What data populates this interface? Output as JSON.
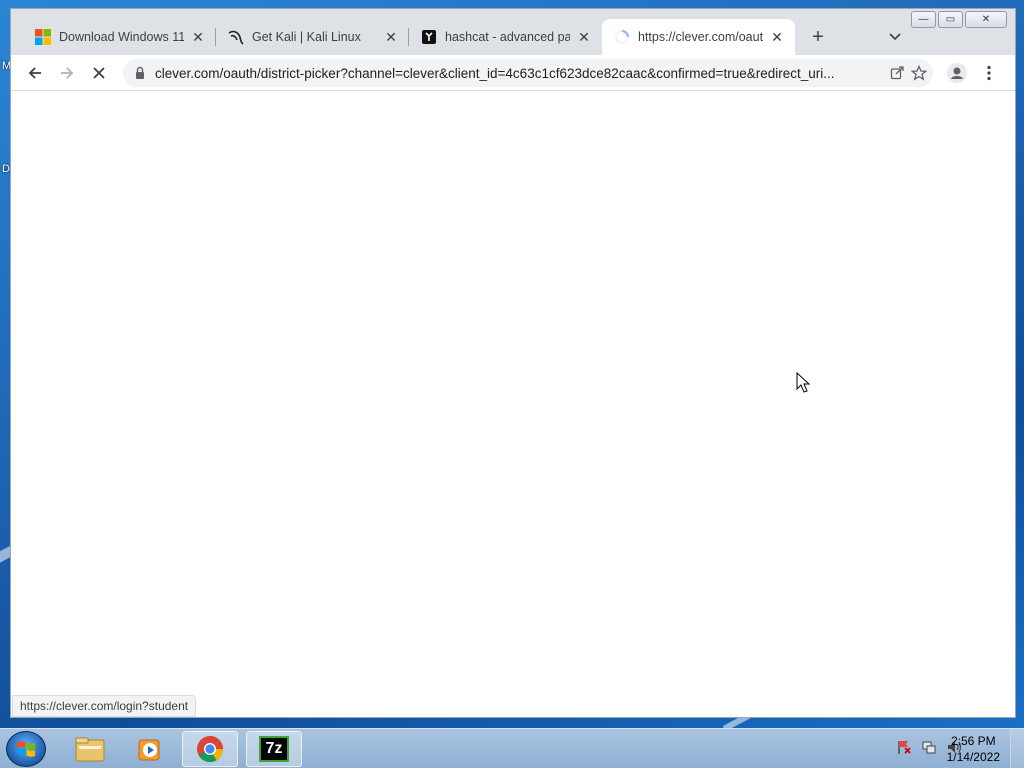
{
  "desktop": {
    "left_labels": [
      "M",
      "D"
    ]
  },
  "window": {
    "caption_buttons": {
      "minimize": "—",
      "maximize": "▭",
      "close": "✕"
    }
  },
  "tabs": [
    {
      "title": "Download Windows 11",
      "favicon": "windows-logo-icon"
    },
    {
      "title": "Get Kali | Kali Linux",
      "favicon": "kali-dragon-icon"
    },
    {
      "title": "hashcat - advanced password recovery",
      "favicon": "hashcat-cat-icon"
    },
    {
      "title": "https://clever.com/oauth/district-picker",
      "favicon": "loading-spinner-icon",
      "active": true
    }
  ],
  "toolbar": {
    "url": "clever.com/oauth/district-picker?channel=clever&client_id=4c63c1cf623dce82caac&confirmed=true&redirect_uri..."
  },
  "status_bar": {
    "link_url": "https://clever.com/login?student"
  },
  "taskbar": {
    "apps": [
      "windows-explorer-icon",
      "media-player-icon",
      "chrome-icon",
      "7zip-icon"
    ],
    "tray_icons": [
      "action-center-flag-icon",
      "network-icon",
      "volume-icon"
    ],
    "time": "2:56 PM",
    "date": "1/14/2022",
    "seven_zip_label": "7z"
  }
}
